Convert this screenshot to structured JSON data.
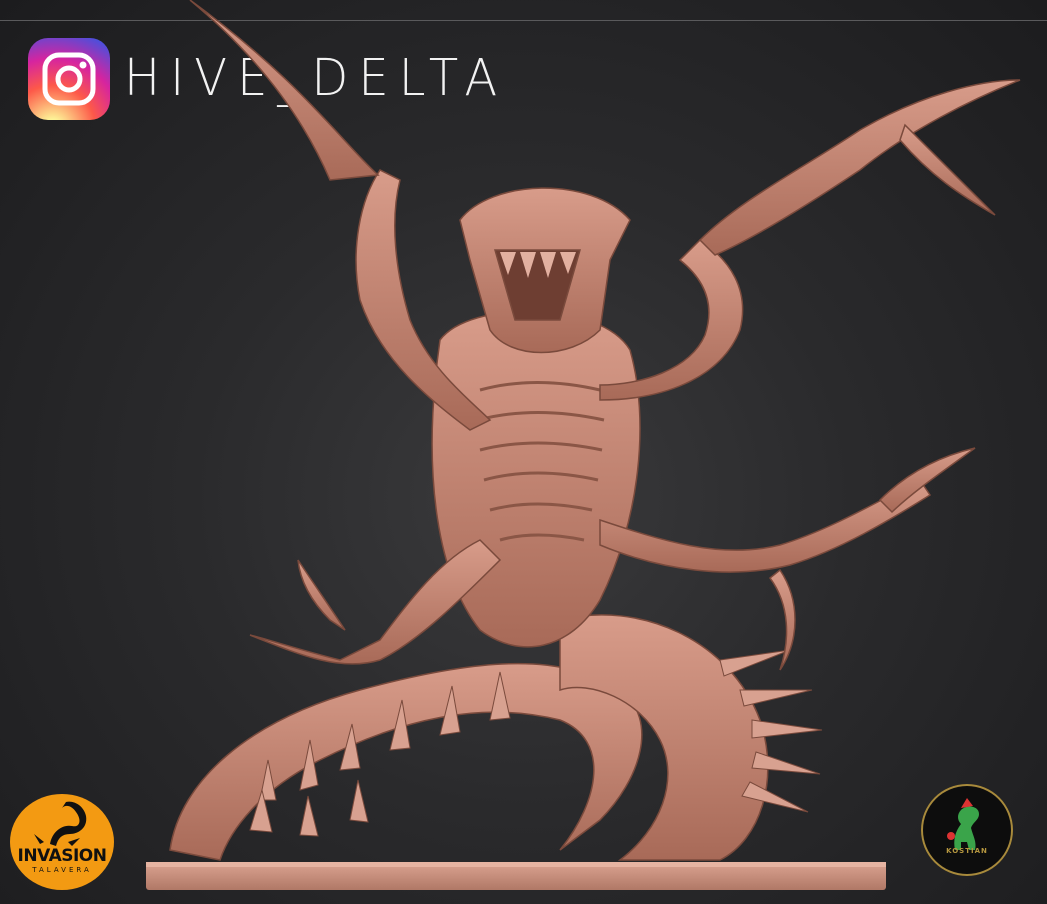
{
  "watermark": {
    "handle": "HIVE_DELTA",
    "platform_icon": "instagram-icon"
  },
  "logos": {
    "left": {
      "text": "INVASION",
      "subtext": "TALAVERA",
      "icon": "scorpion-icon"
    },
    "right": {
      "text": "KOSTIAN",
      "icon": "dinosaur-icon"
    }
  },
  "colors": {
    "background": "#2a2a2c",
    "model": "#c98a78",
    "base": "#d49a88",
    "invasion_orange": "#f39a12",
    "kostian_gold": "#b5963f"
  }
}
